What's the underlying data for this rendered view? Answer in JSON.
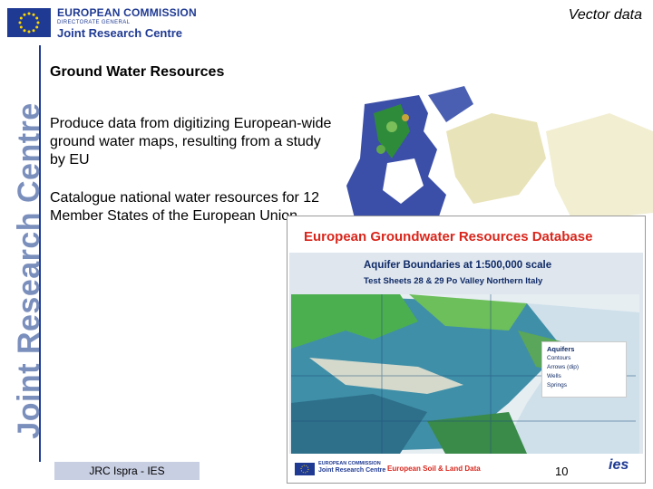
{
  "header": {
    "org_title": "EUROPEAN COMMISSION",
    "directorate": "DIRECTORATE GENERAL",
    "centre": "Joint Research Centre",
    "section_title": "Vector data"
  },
  "sidebar": {
    "text": "Joint Research Centre"
  },
  "content": {
    "heading": "Ground Water Resources",
    "paragraph1": "Produce data from digitizing European-wide ground water maps, resulting from a study by EU",
    "paragraph2": "Catalogue national water resources for 12 Member States of the European Union"
  },
  "figure": {
    "title": "European Groundwater Resources Database",
    "subtitle1": "Aquifer Boundaries at 1:500,000 scale",
    "subtitle2": "Test Sheets 28 & 29  Po Valley Northern Italy",
    "legend": {
      "title": "Aquifers",
      "items": [
        "Contours",
        "Arrows (dip)",
        "Wells",
        "Springs"
      ]
    },
    "footer_org": "EUROPEAN COMMISSION",
    "footer_centre": "Joint Research Centre",
    "footer_label": "European Soil & Land Data",
    "footer_logo": "ies"
  },
  "footer": {
    "label": "JRC Ispra - IES",
    "page_number": "10"
  },
  "colors": {
    "accent": "#1f3a93",
    "figure_title": "#d9261c",
    "footer_box": "#c9cfe3"
  }
}
